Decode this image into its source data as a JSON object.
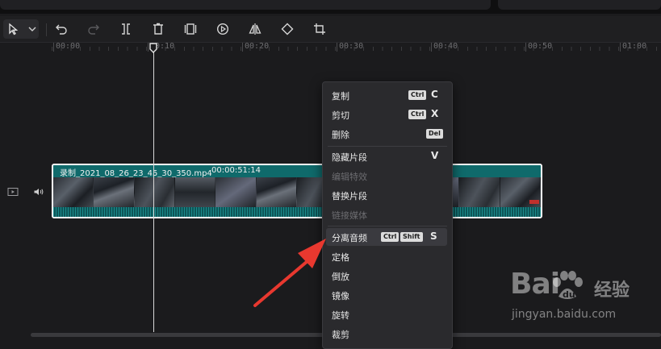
{
  "ruler": {
    "ticks": [
      "00:00",
      "00:10",
      "00:20",
      "00:30",
      "00:40",
      "00:50",
      "01:00"
    ]
  },
  "clip": {
    "name": "录制_2021_08_26_23_45_30_350.mp4",
    "duration": "00:00:51:14"
  },
  "toolbar": {
    "icons": [
      "cursor-select-icon",
      "chevron-down-icon",
      "undo-icon",
      "redo-icon",
      "split-icon",
      "delete-icon",
      "freeze-icon",
      "play-reverse-icon",
      "mirror-icon",
      "rotate-icon",
      "crop-icon"
    ]
  },
  "context_menu": {
    "items": [
      {
        "label": "复制",
        "mods": [
          "Ctrl"
        ],
        "key": "C"
      },
      {
        "label": "剪切",
        "mods": [
          "Ctrl"
        ],
        "key": "X"
      },
      {
        "label": "删除",
        "mods": [
          "Del"
        ],
        "key": ""
      },
      {
        "label": "隐藏片段",
        "mods": [],
        "key": "V"
      },
      {
        "label": "编辑特效",
        "mods": [],
        "key": ""
      },
      {
        "label": "替换片段",
        "mods": [],
        "key": ""
      },
      {
        "label": "链接媒体",
        "mods": [],
        "key": ""
      },
      {
        "label": "分离音频",
        "mods": [
          "Ctrl",
          "Shift"
        ],
        "key": "S"
      },
      {
        "label": "定格",
        "mods": [],
        "key": ""
      },
      {
        "label": "倒放",
        "mods": [],
        "key": ""
      },
      {
        "label": "镜像",
        "mods": [],
        "key": ""
      },
      {
        "label": "旋转",
        "mods": [],
        "key": ""
      },
      {
        "label": "裁剪",
        "mods": [],
        "key": ""
      }
    ]
  },
  "watermark": {
    "brand_left": "Bai",
    "brand_right": "经验",
    "url": "jingyan.baidu.com"
  },
  "colors": {
    "clip_fill": "#0e5a5c",
    "arrow": "#e8382f",
    "menu_bg": "#2a2a2d"
  }
}
